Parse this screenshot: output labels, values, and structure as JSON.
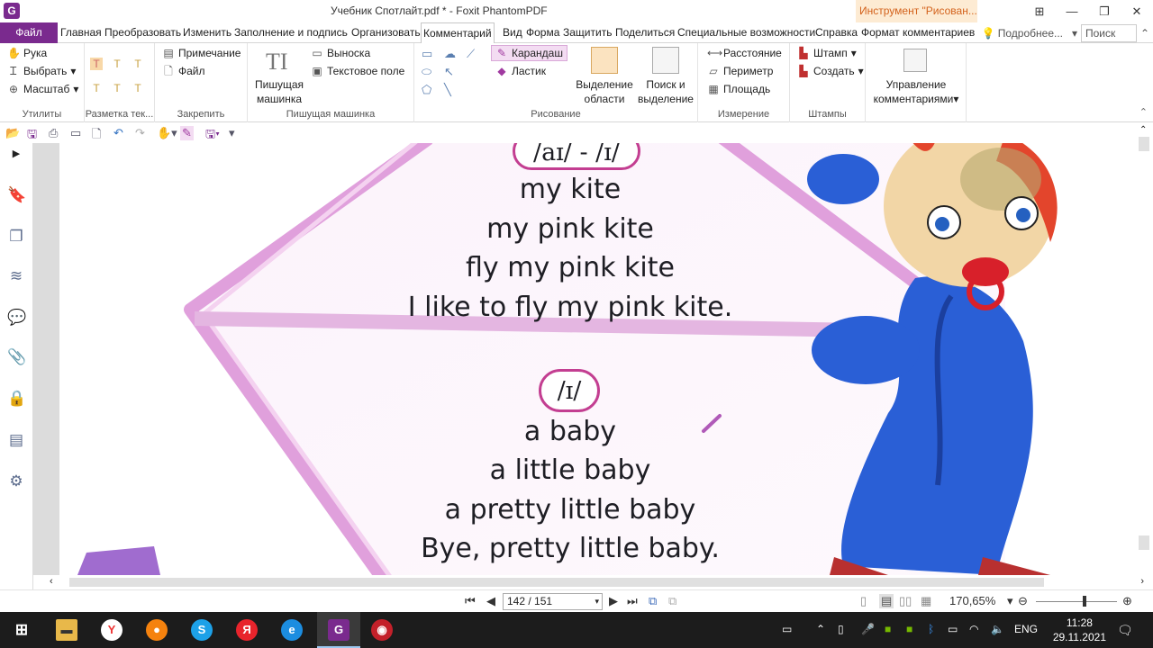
{
  "window": {
    "title": "Учебник Спотлайт.pdf * - Foxit PhantomPDF",
    "context_tool": "Инструмент \"Рисован...",
    "colors": {
      "accent": "#7a2a8e",
      "context_bg": "#fdebd3",
      "context_text": "#d3621c"
    }
  },
  "menu": {
    "file": "Файл",
    "tabs": [
      "Главная",
      "Преобразовать",
      "Изменить",
      "Заполнение и подпись",
      "Организовать",
      "Комментарий",
      "Вид",
      "Форма",
      "Защитить",
      "Поделиться",
      "Специальные возможности",
      "Справка",
      "Формат комментариев"
    ],
    "active_tab": "Комментарий",
    "tell_me": "Подробнее...",
    "search": "Поиск"
  },
  "ribbon": {
    "utilities": {
      "label": "Утилиты",
      "hand": "Рука",
      "select": "Выбрать",
      "zoom": "Масштаб"
    },
    "text_markup": {
      "label": "Разметка тек..."
    },
    "pin": {
      "label": "Закрепить",
      "note": "Примечание",
      "file": "Файл"
    },
    "typewriter": {
      "label": "Пишущая машинка",
      "typewriter_big_line1": "Пишущая",
      "typewriter_big_line2": "машинка",
      "callout": "Выноска",
      "textbox": "Текстовое поле"
    },
    "drawing": {
      "label": "Рисование",
      "pencil": "Карандаш",
      "eraser": "Ластик",
      "area_highlight_line1": "Выделение",
      "area_highlight_line2": "области",
      "search_highlight_line1": "Поиск и",
      "search_highlight_line2": "выделение"
    },
    "measure": {
      "label": "Измерение",
      "distance": "Расстояние",
      "perimeter": "Периметр",
      "area": "Площадь"
    },
    "stamps": {
      "label": "Штампы",
      "stamp": "Штамп",
      "create": "Создать"
    },
    "manage": {
      "line1": "Управление",
      "line2": "комментариями"
    }
  },
  "document": {
    "colors": {
      "kite_pink": "#e9a6e3",
      "pill_border": "#c33e91",
      "baby_blue": "#2a5fd6"
    },
    "pill1": "/aɪ/ - /ɪ/",
    "lines1": [
      "my kite",
      "my pink kite",
      "fly my pink kite",
      "I like to fly my pink kite."
    ],
    "pill2": "/ɪ/",
    "lines2": [
      "a baby",
      "a little baby",
      "a pretty little baby",
      "Bye, pretty little baby."
    ]
  },
  "status": {
    "page": "142 / 151",
    "zoom": "170,65%"
  },
  "taskbar": {
    "lang": "ENG",
    "time": "11:28",
    "date": "29.11.2021"
  }
}
